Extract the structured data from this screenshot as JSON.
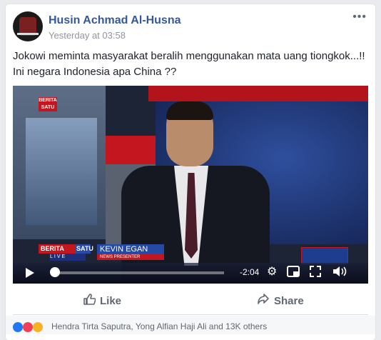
{
  "post": {
    "author": "Husin Achmad Al-Husna",
    "timestamp": "Yesterday at 03:58",
    "more_icon": "more-options-icon",
    "text_line1": "Jokowi meminta masyarakat beralih menggunakan mata uang tiongkok...!!",
    "text_line2": "Ini negara Indonesia apa China ??"
  },
  "video": {
    "channel_logo": "BERITA SATU",
    "lower_third": {
      "brand_red": "BERITA",
      "brand_blue": "SATU",
      "live": "LIVE",
      "name": "KEVIN EGAN",
      "role": "NEWS PRESENTER"
    },
    "remaining_time": "-2:04",
    "progress": 0.02,
    "icons": [
      "play-icon",
      "settings-gear-icon",
      "picture-in-picture-icon",
      "fullscreen-icon",
      "volume-icon"
    ]
  },
  "actions": {
    "like_label": "Like",
    "share_label": "Share",
    "like_icon": "thumbs-up-icon",
    "share_icon": "share-arrow-icon"
  },
  "reactions": {
    "summary": "Hendra Tirta Saputra, Yong Alfian Haji Ali and 13K others",
    "colors": {
      "like": "#2078f4",
      "love": "#f33e58",
      "haha": "#f7b125"
    }
  }
}
